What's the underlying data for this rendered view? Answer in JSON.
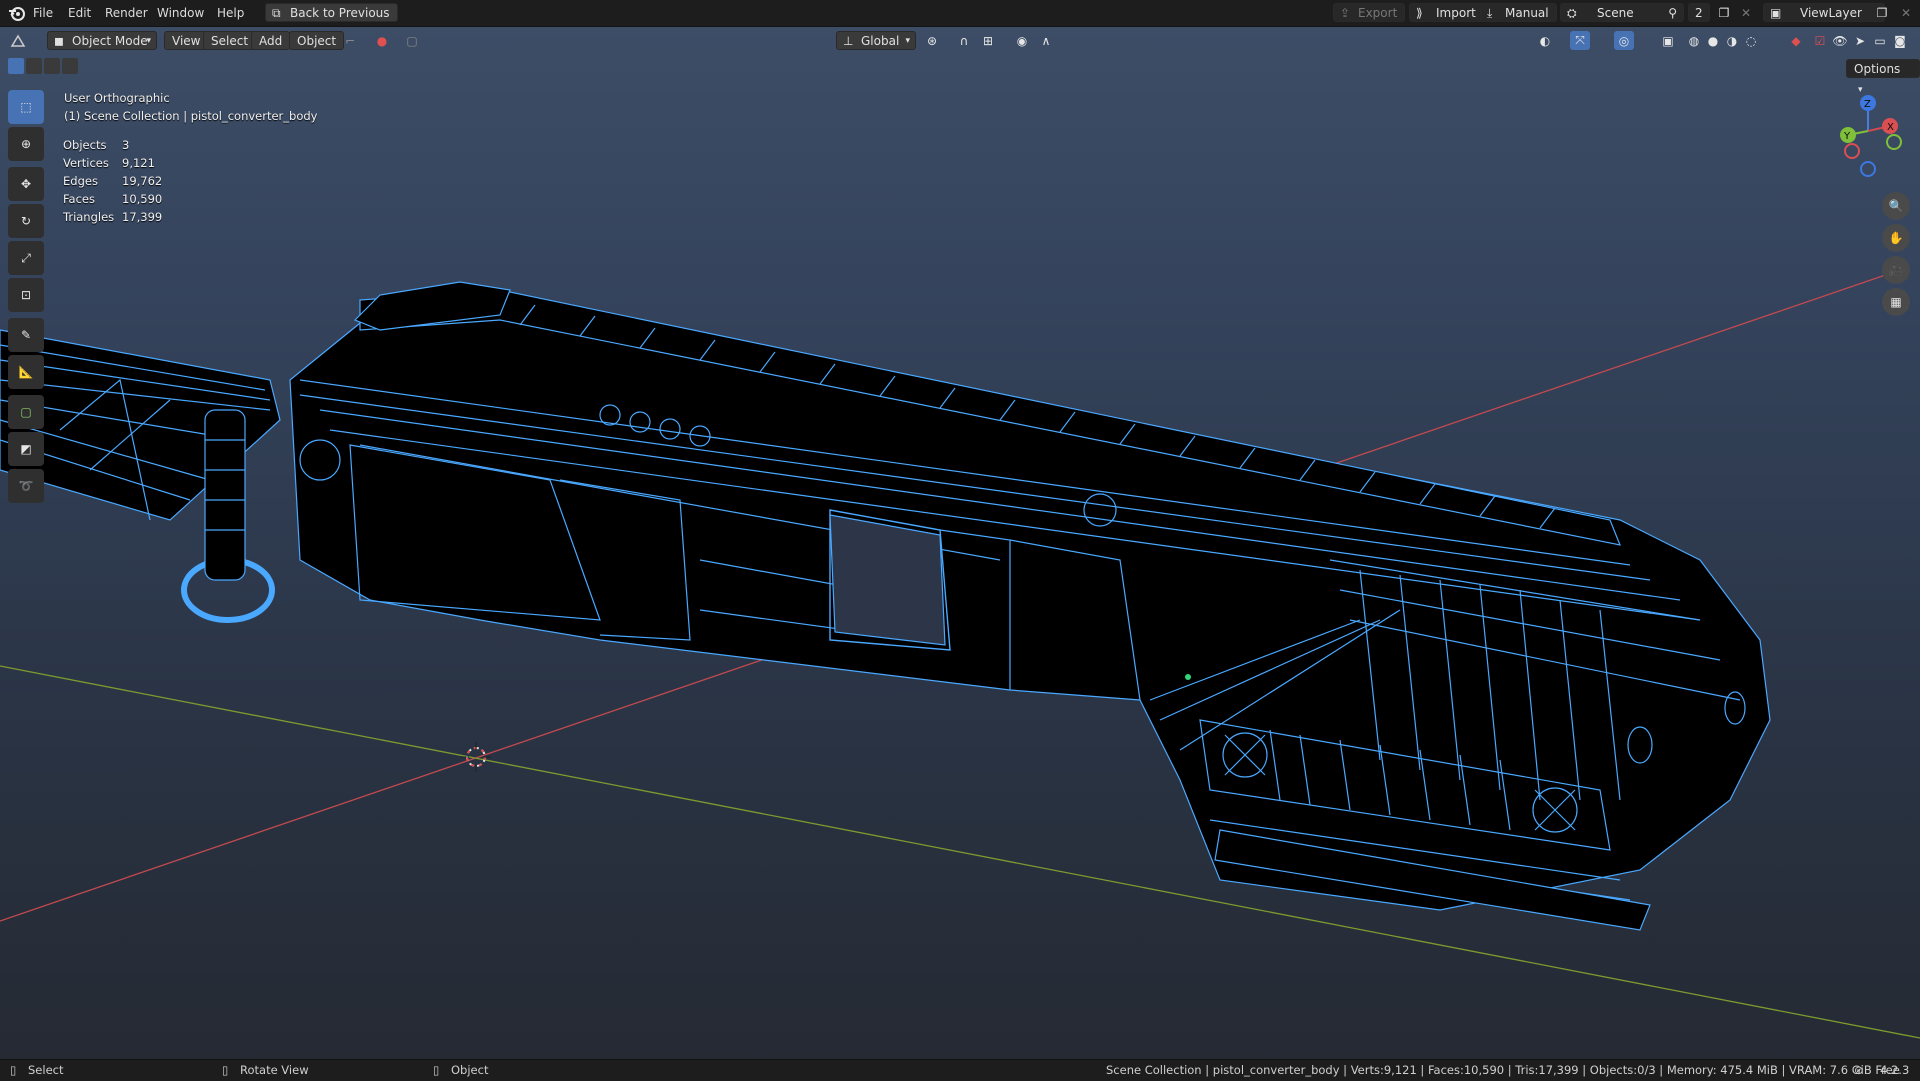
{
  "menubar": {
    "items": [
      "File",
      "Edit",
      "Render",
      "Window",
      "Help"
    ],
    "back_button": "Back to Previous",
    "export": "Export",
    "import": "Import",
    "manual": "Manual",
    "scene": "Scene",
    "scene_count": "2",
    "view_layer": "ViewLayer"
  },
  "header": {
    "mode": "Object Mode",
    "view": "View",
    "select": "Select",
    "add": "Add",
    "object": "Object",
    "orientation": "Global",
    "options": "Options"
  },
  "overlay": {
    "view_name": "User Orthographic",
    "collection": "(1) Scene Collection | pistol_converter_body",
    "stats": [
      {
        "label": "Objects",
        "value": "3"
      },
      {
        "label": "Vertices",
        "value": "9,121"
      },
      {
        "label": "Edges",
        "value": "19,762"
      },
      {
        "label": "Faces",
        "value": "10,590"
      },
      {
        "label": "Triangles",
        "value": "17,399"
      }
    ]
  },
  "gizmo": {
    "x": "X",
    "y": "Y",
    "z": "Z"
  },
  "statusbar": {
    "select": "Select",
    "rotate": "Rotate View",
    "object": "Object",
    "info": "Scene Collection | pistol_converter_body | Verts:9,121 | Faces:10,590 | Tris:17,399 | Objects:0/3 | Memory: 475.4 MiB | VRAM: 7.6 GiB Free",
    "version": "4.2.3"
  },
  "colors": {
    "accent": "#4772b3",
    "wire": "#4aa8ff",
    "x_axis": "#c24a4f",
    "y_axis": "#7d9b2f"
  }
}
